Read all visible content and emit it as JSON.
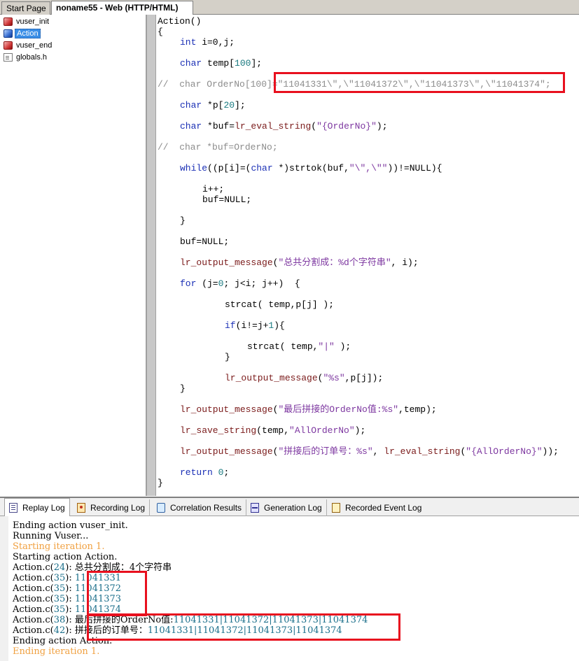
{
  "tabs": [
    {
      "label": "Start Page"
    },
    {
      "label": "noname55 - Web (HTTP/HTML)"
    }
  ],
  "tree": {
    "items": [
      {
        "label": "vuser_init",
        "icon": "action-red-icon"
      },
      {
        "label": "Action",
        "icon": "action-blue-icon",
        "selected": true
      },
      {
        "label": "vuser_end",
        "icon": "action-red-icon"
      },
      {
        "label": "globals.h",
        "icon": "header-file-icon"
      }
    ]
  },
  "code": {
    "l1": "Action()",
    "l2": "{",
    "l3_kw": "int",
    "l3_rest": " i=0,j;",
    "l4_kw": "char",
    "l4_a": " temp[",
    "l4_num": "100",
    "l4_b": "];",
    "l5": "//  char OrderNo[100]=\"11041331\\\",\\\"11041372\\\",\\\"11041373\\\",\\\"11041374\";",
    "l6_kw": "char",
    "l6_a": " *p[",
    "l6_num": "20",
    "l6_b": "];",
    "l7_kw": "char",
    "l7_a": " *buf=",
    "l7_fn": "lr_eval_string",
    "l7_b": "(",
    "l7_str": "\"{OrderNo}\"",
    "l7_c": ");",
    "l8": "//  char *buf=OrderNo;",
    "l9_kw": "while",
    "l9_a": "((p[i]=(",
    "l9_kw2": "char",
    "l9_b": " *)strtok(buf,",
    "l9_str": "\"\\\",\\\"\"",
    "l9_c": "))!=NULL){",
    "l10": "i++;",
    "l11": "buf=NULL;",
    "l12": "}",
    "l13": "buf=NULL;",
    "l14_fn": "lr_output_message",
    "l14_a": "(",
    "l14_str": "\"总共分割成：%d个字符串\"",
    "l14_b": ", i);",
    "l15_kw": "for",
    "l15_a": " (j=",
    "l15_num": "0",
    "l15_b": "; j<i; j++)  {",
    "l16": "strcat( temp,p[j] );",
    "l17_kw": "if",
    "l17_a": "(i!=j+",
    "l17_num": "1",
    "l17_b": "){",
    "l18_a": "strcat( temp,",
    "l18_str": "\"|\"",
    "l18_b": " );",
    "l19": "}",
    "l20_fn": "lr_output_message",
    "l20_a": "(",
    "l20_str": "\"%s\"",
    "l20_b": ",p[j]);",
    "l21": "}",
    "l22_fn": "lr_output_message",
    "l22_a": "(",
    "l22_str": "\"最后拼接的OrderNo值:%s\"",
    "l22_b": ",temp);",
    "l23_fn": "lr_save_string",
    "l23_a": "(temp,",
    "l23_str": "\"AllOrderNo\"",
    "l23_b": ");",
    "l24_fn": "lr_output_message",
    "l24_a": "(",
    "l24_str": "\"拼接后的订单号：%s\"",
    "l24_b": ", ",
    "l24_fn2": "lr_eval_string",
    "l24_c": "(",
    "l24_str2": "\"{AllOrderNo}\"",
    "l24_d": "));",
    "l25_kw": "return",
    "l25_a": " ",
    "l25_num": "0",
    "l25_b": ";",
    "l26": "}"
  },
  "bottom_tabs": [
    {
      "label": "Replay Log",
      "icon": "replay-log-icon",
      "active": true
    },
    {
      "label": "Recording Log",
      "icon": "recording-log-icon"
    },
    {
      "label": "Correlation Results",
      "icon": "correlation-icon"
    },
    {
      "label": "Generation Log",
      "icon": "generation-log-icon"
    },
    {
      "label": "Recorded Event Log",
      "icon": "recorded-event-log-icon"
    }
  ],
  "log": {
    "l1": "Ending action vuser_init.",
    "l2": "Running Vuser...",
    "l3": "Starting iteration 1.",
    "l4": "Starting action Action.",
    "l5_a": "Action.c(",
    "l5_n": "24",
    "l5_b": "): 总共分割成：4个字符串",
    "l6_a": "Action.c(",
    "l6_n": "35",
    "l6_b": "): ",
    "l6_v": "11041331",
    "l7_a": "Action.c(",
    "l7_n": "35",
    "l7_b": "): ",
    "l7_v": "11041372",
    "l8_a": "Action.c(",
    "l8_n": "35",
    "l8_b": "): ",
    "l8_v": "11041373",
    "l9_a": "Action.c(",
    "l9_n": "35",
    "l9_b": "): ",
    "l9_v": "11041374",
    "l10_a": "Action.c(",
    "l10_n": "38",
    "l10_b": "): 最后拼接的OrderNo值:",
    "l10_v": "11041331|11041372|11041373|11041374",
    "l11_a": "Action.c(",
    "l11_n": "42",
    "l11_b": "): 拼接后的订单号：",
    "l11_v": "11041331|11041372|11041373|11041374",
    "l12": "Ending action Action.",
    "l13": "Ending iteration 1."
  },
  "colors": {
    "highlight": "#e8101e",
    "keyword": "#1a2fb5",
    "function": "#7a1a1a",
    "string": "#7d37a0",
    "comment": "#8c8c8c",
    "iteration_log": "#f0a040"
  }
}
